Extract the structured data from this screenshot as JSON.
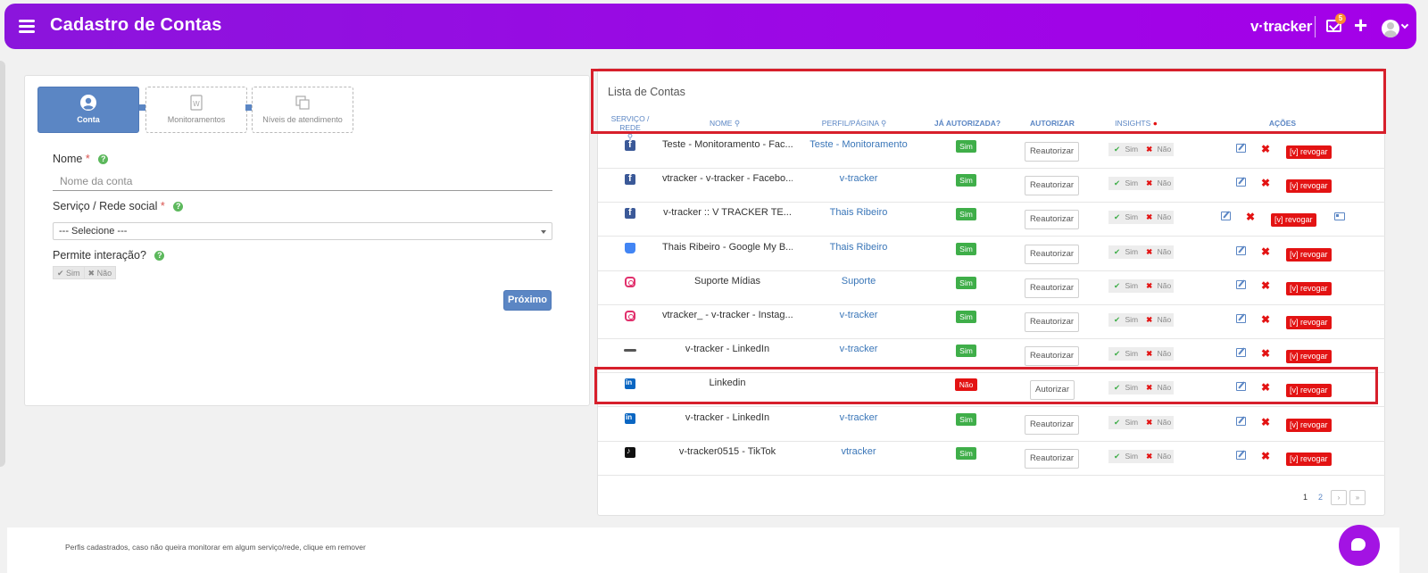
{
  "header": {
    "title": "Cadastro de Contas",
    "brand": "v·tracker",
    "notifications_count": "5"
  },
  "steps": [
    {
      "label": "Conta",
      "icon": "user-circle-icon",
      "active": true
    },
    {
      "label": "Monitoramentos",
      "icon": "document-icon",
      "active": false
    },
    {
      "label": "Níveis de atendimento",
      "icon": "copy-icon",
      "active": false
    }
  ],
  "form": {
    "name_label": "Nome",
    "name_placeholder": "Nome da conta",
    "service_label": "Serviço / Rede social",
    "service_selected": "--- Selecione ---",
    "interaction_label": "Permite interação?",
    "toggle_yes": "✔ Sim",
    "toggle_no": "✖ Não",
    "next_label": "Próximo",
    "required_mark": "*",
    "help_mark": "?"
  },
  "list": {
    "title": "Lista de Contas",
    "columns": {
      "service": "SERVIÇO / REDE",
      "name": "NOME",
      "profile": "PERFIL/PÁGINA",
      "authorized": "JÁ AUTORIZADA?",
      "authorize": "AUTORIZAR",
      "insights": "INSIGHTS",
      "actions": "AÇÕES"
    },
    "labels": {
      "reauthorize": "Reautorizar",
      "authorize": "Autorizar",
      "yes": "Sim",
      "no": "Não",
      "revoke": "[v] revogar",
      "ins_yes": "✔ Sim",
      "ins_no": "✖ Não"
    },
    "rows": [
      {
        "service": "facebook",
        "name": "Teste - Monitoramento - Fac...",
        "profile": "Teste - Monitoramento",
        "authorized": "Sim",
        "button": "Reautorizar"
      },
      {
        "service": "facebook",
        "name": "vtracker - v-tracker - Facebo...",
        "profile": "v-tracker",
        "authorized": "Sim",
        "button": "Reautorizar"
      },
      {
        "service": "facebook",
        "name": "v-tracker :: V TRACKER TE...",
        "profile": "Thais Ribeiro",
        "authorized": "Sim",
        "button": "Reautorizar"
      },
      {
        "service": "google-my-business",
        "name": "Thais Ribeiro - Google My B...",
        "profile": "Thais Ribeiro",
        "authorized": "Sim",
        "button": "Reautorizar"
      },
      {
        "service": "instagram",
        "name": "Suporte Mídias",
        "profile": "Suporte",
        "authorized": "Sim",
        "button": "Reautorizar"
      },
      {
        "service": "instagram",
        "name": "vtracker_ - v-tracker - Instag...",
        "profile": "v-tracker",
        "authorized": "Sim",
        "button": "Reautorizar"
      },
      {
        "service": "linkedin-line",
        "name": "v-tracker - LinkedIn",
        "profile": "v-tracker",
        "authorized": "Sim",
        "button": "Reautorizar"
      },
      {
        "service": "linkedin",
        "name": "Linkedin",
        "profile": "",
        "authorized": "Não",
        "button": "Autorizar"
      },
      {
        "service": "linkedin",
        "name": "v-tracker - LinkedIn",
        "profile": "v-tracker",
        "authorized": "Sim",
        "button": "Reautorizar"
      },
      {
        "service": "tiktok",
        "name": "v-tracker0515 - TikTok",
        "profile": "vtracker",
        "authorized": "Sim",
        "button": "Reautorizar"
      }
    ],
    "pagination": {
      "page1": "1",
      "page2": "2",
      "next": "›",
      "last": "»"
    }
  },
  "footer": {
    "text": "Perfis cadastrados, caso não queira monitorar em algum serviço/rede, clique em remover"
  },
  "colors": {
    "header": "#9d07e6",
    "accent": "#5b86c4",
    "success": "#3fae49",
    "danger": "#e31313",
    "highlight": "#d71f2b"
  }
}
